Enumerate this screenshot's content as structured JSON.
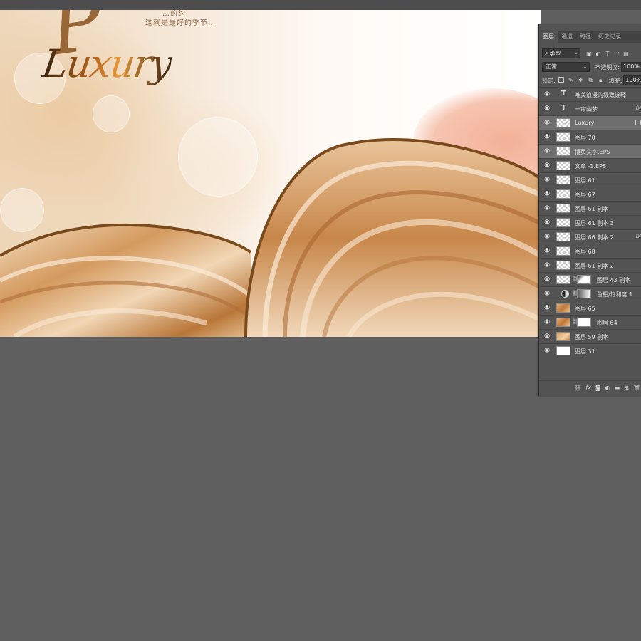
{
  "canvas": {
    "top_text_1": "…的约",
    "top_text_2": "这就是最好的季节…",
    "logo_letter": "P",
    "logo_word": "Luxury"
  },
  "layers_panel": {
    "tabs": [
      {
        "label": "图层",
        "active": true
      },
      {
        "label": "通道",
        "active": false
      },
      {
        "label": "路径",
        "active": false
      },
      {
        "label": "历史记录",
        "active": false
      }
    ],
    "kind_filter": "类型",
    "blend_mode": "正常",
    "opacity_label": "不透明度:",
    "opacity_value": "100%",
    "lock_label": "锁定:",
    "fill_label": "填充:",
    "fill_value": "100%",
    "layers": [
      {
        "name": "唯美浪漫的极致诠释",
        "type": "text",
        "fx": false
      },
      {
        "name": "一帘幽梦",
        "type": "text",
        "fx": true
      },
      {
        "name": "Luxury",
        "type": "raster",
        "selected": true,
        "locked": true
      },
      {
        "name": "图层 70",
        "type": "raster"
      },
      {
        "name": "插页文字.EPS",
        "type": "raster",
        "selected": true
      },
      {
        "name": "文章 -1.EPS",
        "type": "raster"
      },
      {
        "name": "图层 61",
        "type": "raster"
      },
      {
        "name": "图层 67",
        "type": "raster"
      },
      {
        "name": "图层 61 副本",
        "type": "raster"
      },
      {
        "name": "图层 61 副本 3",
        "type": "raster"
      },
      {
        "name": "图层 66 副本 2",
        "type": "raster",
        "fx": true
      },
      {
        "name": "图层 68",
        "type": "raster"
      },
      {
        "name": "图层 61 副本 2",
        "type": "raster"
      },
      {
        "name": "图层 43 副本",
        "type": "masked"
      },
      {
        "name": "色相/饱和度 1",
        "type": "adjustment"
      },
      {
        "name": "图层 65",
        "type": "photo"
      },
      {
        "name": "图层 64",
        "type": "photo-masked"
      },
      {
        "name": "图层 59 副本",
        "type": "photo2"
      },
      {
        "name": "图层 31",
        "type": "white"
      }
    ],
    "fx_label": "fx",
    "bottom_icons": [
      "link-icon",
      "fx-icon",
      "mask-icon",
      "adjustment-icon",
      "folder-icon",
      "new-layer-icon",
      "trash-icon"
    ]
  }
}
